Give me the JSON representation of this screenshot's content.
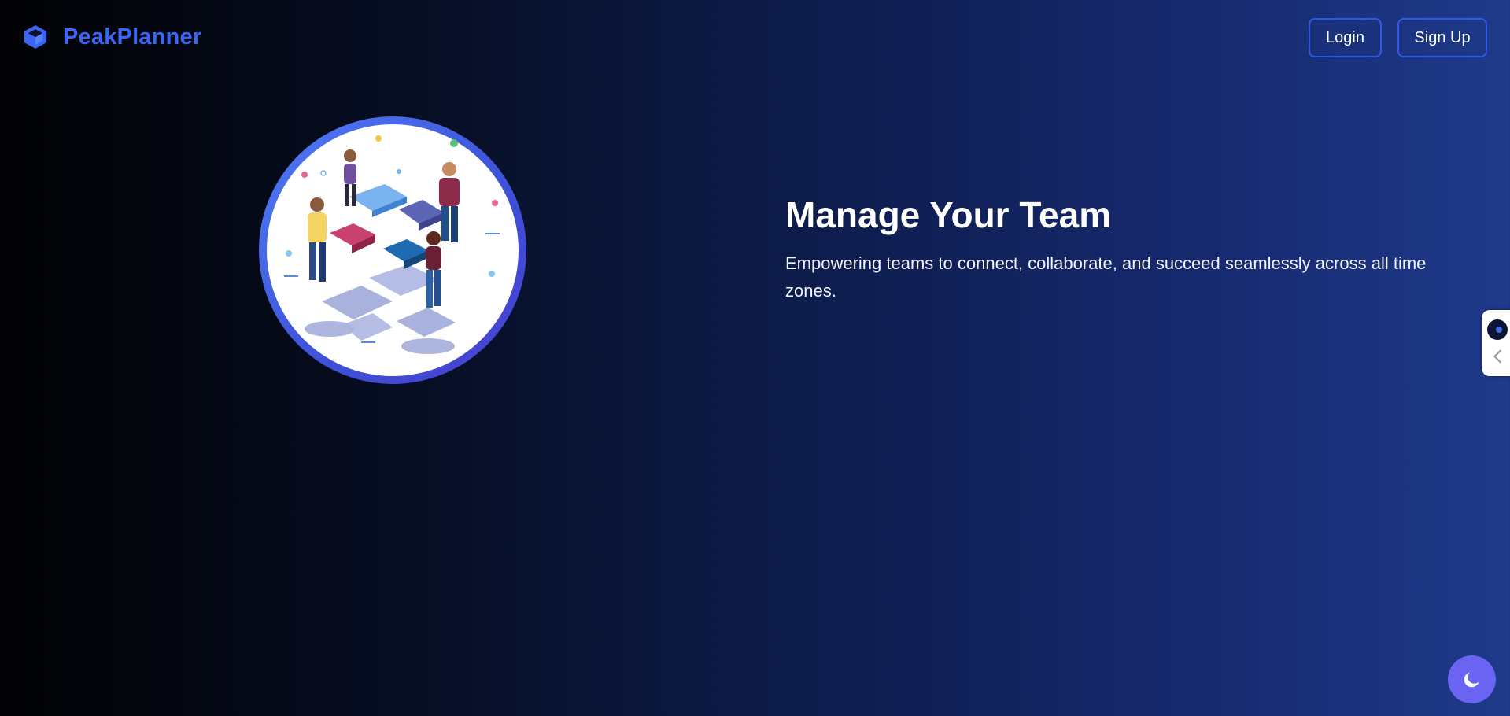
{
  "brand": {
    "name": "PeakPlanner",
    "icon": "cube-icon",
    "color": "#3b66f5"
  },
  "nav": {
    "login_label": "Login",
    "signup_label": "Sign Up",
    "border_color": "#2f5ae8"
  },
  "hero": {
    "title": "Manage Your Team",
    "subtitle": "Empowering teams to connect, collaborate, and succeed seamlessly across all time zones.",
    "illustration": "team-puzzle-illustration"
  },
  "side_widget": {
    "icons": [
      "assistant-dot-icon",
      "chevron-left-icon"
    ]
  },
  "theme_toggle": {
    "icon": "moon-icon",
    "color": "#6b64f2"
  },
  "colors": {
    "background_start": "#020204",
    "background_end": "#1e3a8a",
    "text": "#ffffff"
  }
}
